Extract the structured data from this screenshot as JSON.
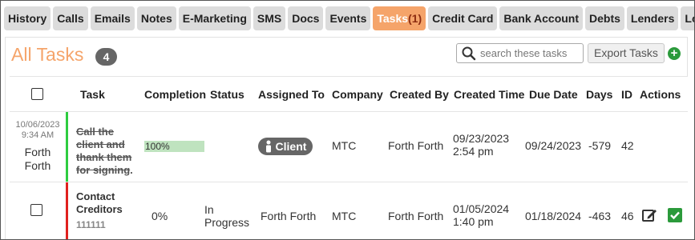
{
  "tabs": [
    {
      "label": "History"
    },
    {
      "label": "Calls"
    },
    {
      "label": "Emails"
    },
    {
      "label": "Notes"
    },
    {
      "label": "E-Marketing"
    },
    {
      "label": "SMS"
    },
    {
      "label": "Docs"
    },
    {
      "label": "Events"
    },
    {
      "label": "Tasks",
      "count": "(1)",
      "active": true
    },
    {
      "label": "Credit Card"
    },
    {
      "label": "Bank Account"
    },
    {
      "label": "Debts"
    },
    {
      "label": "Lenders"
    },
    {
      "label": "Loans"
    }
  ],
  "panel": {
    "title": "All Tasks",
    "badge": "4",
    "search": {
      "placeholder": "search these tasks",
      "value": ""
    },
    "export_label": "Export Tasks",
    "add_label": "+"
  },
  "columns": {
    "task": "Task",
    "completion": "Completion",
    "status": "Status",
    "assigned_to": "Assigned To",
    "company": "Company",
    "created_by": "Created By",
    "created_time": "Created Time",
    "due_date": "Due Date",
    "days": "Days",
    "id": "ID",
    "actions": "Actions"
  },
  "rows": [
    {
      "completed_date": "10/06/2023",
      "completed_time": "9:34 AM",
      "completed_by": "Forth Forth",
      "task": "Call the client and thank them for signing",
      "task_suffix": ".",
      "completion": "100%",
      "completion_value": 1.0,
      "status": "",
      "assigned_to": "Client",
      "company": "MTC",
      "created_by": "Forth Forth",
      "created_date": "09/23/2023",
      "created_time": "2:54 pm",
      "due_date": "09/24/2023",
      "days": "-579",
      "id": "42",
      "bar_color": "#2ecc40"
    },
    {
      "task": "Contact Creditors",
      "task_sub": "111111",
      "completion": "0%",
      "status": "In Progress",
      "assigned_to": "Forth Forth",
      "company": "MTC",
      "created_by": "Forth Forth",
      "created_date": "01/05/2024",
      "created_time": "1:40 pm",
      "due_date": "01/18/2024",
      "days": "-463",
      "id": "46",
      "bar_color": "#e0201e"
    }
  ],
  "colors": {
    "accent": "#f5a46a",
    "add_button": "#2b9a3b",
    "complete_check": "#2b9a3b"
  },
  "icons": {
    "search": "search-icon",
    "add": "plus-circle-icon",
    "edit": "edit-icon",
    "complete": "check-square-icon",
    "person": "person-icon"
  }
}
